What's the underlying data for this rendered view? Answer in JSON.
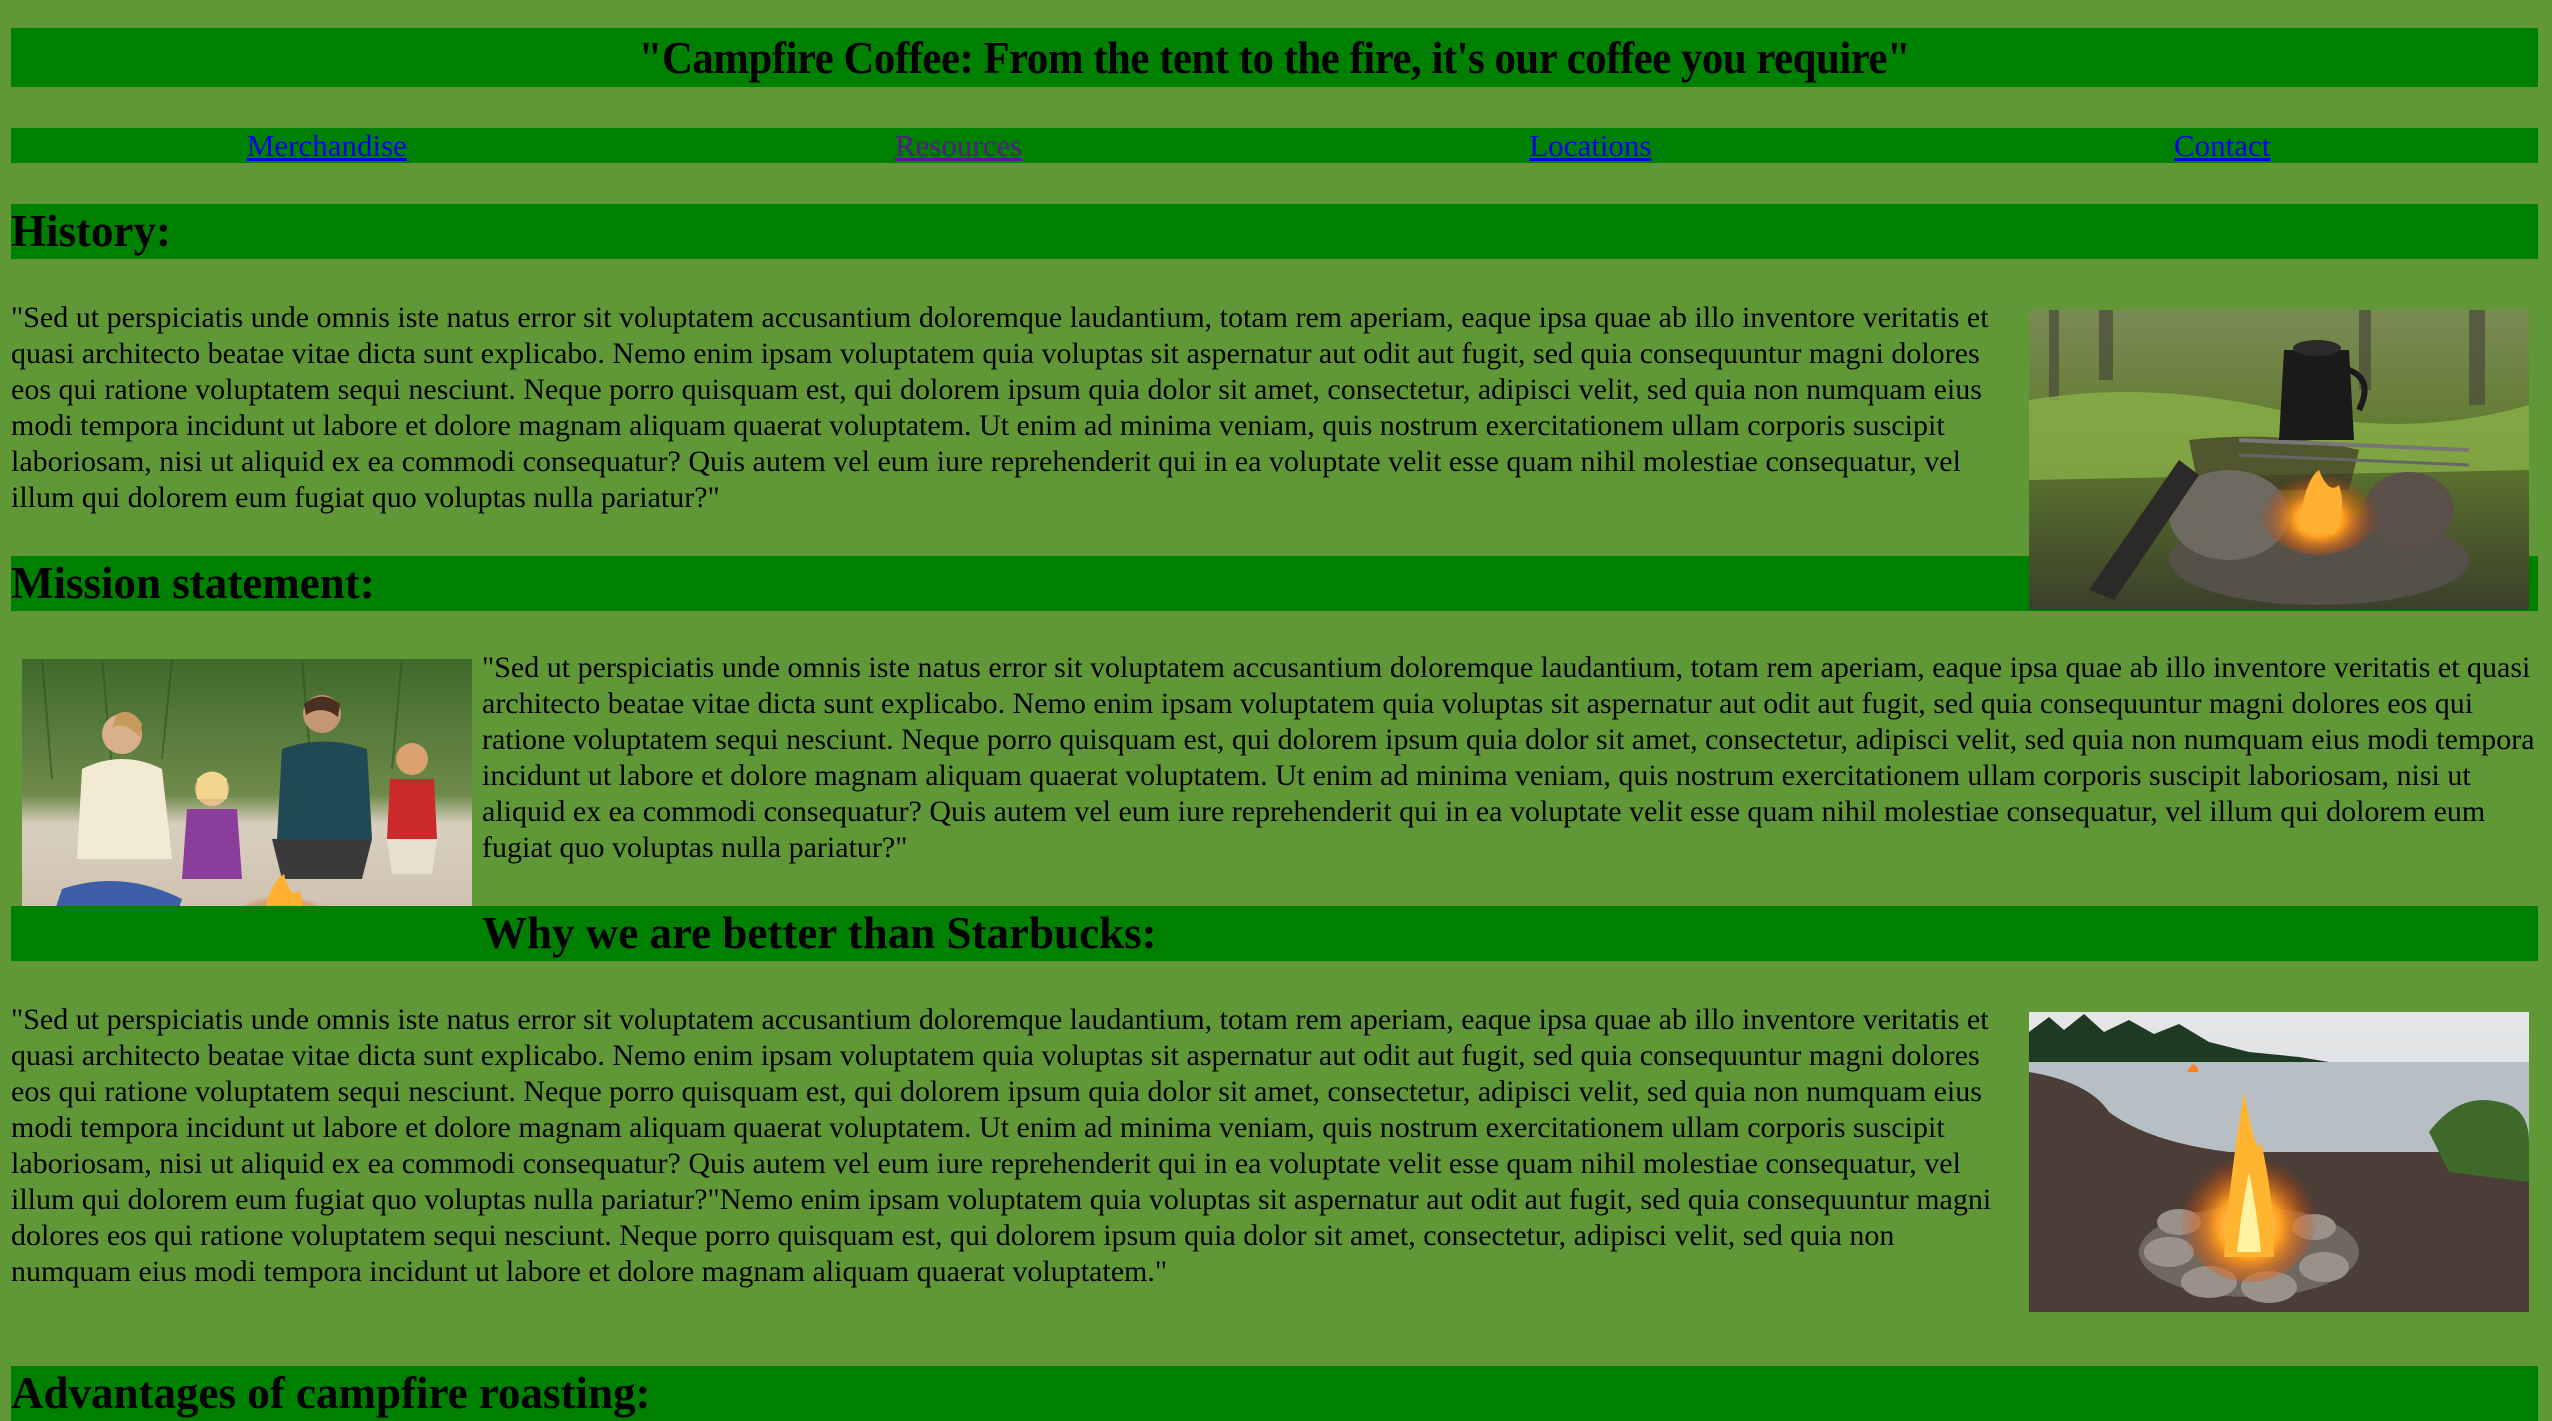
{
  "header": {
    "title": "\"Campfire Coffee: From the tent to the fire, it's our coffee you require\""
  },
  "nav": {
    "items": [
      {
        "label": "Merchandise"
      },
      {
        "label": "Resources"
      },
      {
        "label": "Locations"
      },
      {
        "label": "Contact"
      }
    ]
  },
  "sections": [
    {
      "heading": "History:",
      "text": "\"Sed ut perspiciatis unde omnis iste natus error sit voluptatem accusantium doloremque laudantium, totam rem aperiam, eaque ipsa quae ab illo inventore veritatis et quasi architecto beatae vitae dicta sunt explicabo. Nemo enim ipsam voluptatem quia voluptas sit aspernatur aut odit aut fugit, sed quia consequuntur magni dolores eos qui ratione voluptatem sequi nesciunt. Neque porro quisquam est, qui dolorem ipsum quia dolor sit amet, consectetur, adipisci velit, sed quia non numquam eius modi tempora incidunt ut labore et dolore magnam aliquam quaerat voluptatem. Ut enim ad minima veniam, quis nostrum exercitationem ullam corporis suscipit laboriosam, nisi ut aliquid ex ea commodi consequatur? Quis autem vel eum iure reprehenderit qui in ea voluptate velit esse quam nihil molestiae consequatur, vel illum qui dolorem eum fugiat quo voluptas nulla pariatur?\""
    },
    {
      "heading": "Mission statement:",
      "text": "\"Sed ut perspiciatis unde omnis iste natus error sit voluptatem accusantium doloremque laudantium, totam rem aperiam, eaque ipsa quae ab illo inventore veritatis et quasi architecto beatae vitae dicta sunt explicabo. Nemo enim ipsam voluptatem quia voluptas sit aspernatur aut odit aut fugit, sed quia consequuntur magni dolores eos qui ratione voluptatem sequi nesciunt. Neque porro quisquam est, qui dolorem ipsum quia dolor sit amet, consectetur, adipisci velit, sed quia non numquam eius modi tempora incidunt ut labore et dolore magnam aliquam quaerat voluptatem. Ut enim ad minima veniam, quis nostrum exercitationem ullam corporis suscipit laboriosam, nisi ut aliquid ex ea commodi consequatur? Quis autem vel eum iure reprehenderit qui in ea voluptate velit esse quam nihil molestiae consequatur, vel illum qui dolorem eum fugiat quo voluptas nulla pariatur?\""
    },
    {
      "heading": "Why we are better than Starbucks:",
      "text": "\"Sed ut perspiciatis unde omnis iste natus error sit voluptatem accusantium doloremque laudantium, totam rem aperiam, eaque ipsa quae ab illo inventore veritatis et quasi architecto beatae vitae dicta sunt explicabo. Nemo enim ipsam voluptatem quia voluptas sit aspernatur aut odit aut fugit, sed quia consequuntur magni dolores eos qui ratione voluptatem sequi nesciunt. Neque porro quisquam est, qui dolorem ipsum quia dolor sit amet, consectetur, adipisci velit, sed quia non numquam eius modi tempora incidunt ut labore et dolore magnam aliquam quaerat voluptatem. Ut enim ad minima veniam, quis nostrum exercitationem ullam corporis suscipit laboriosam, nisi ut aliquid ex ea commodi consequatur? Quis autem vel eum iure reprehenderit qui in ea voluptate velit esse quam nihil molestiae consequatur, vel illum qui dolorem eum fugiat quo voluptas nulla pariatur?\"Nemo enim ipsam voluptatem quia voluptas sit aspernatur aut odit aut fugit, sed quia consequuntur magni dolores eos qui ratione voluptatem sequi nesciunt. Neque porro quisquam est, qui dolorem ipsum quia dolor sit amet, consectetur, adipisci velit, sed quia non numquam eius modi tempora incidunt ut labore et dolore magnam aliquam quaerat voluptatem.\""
    },
    {
      "heading": "Advantages of campfire roasting:"
    }
  ],
  "colors": {
    "page_background": "#609837",
    "bar_background": "#008000",
    "link": "#0000ee",
    "visited_link": "#551a8b"
  }
}
